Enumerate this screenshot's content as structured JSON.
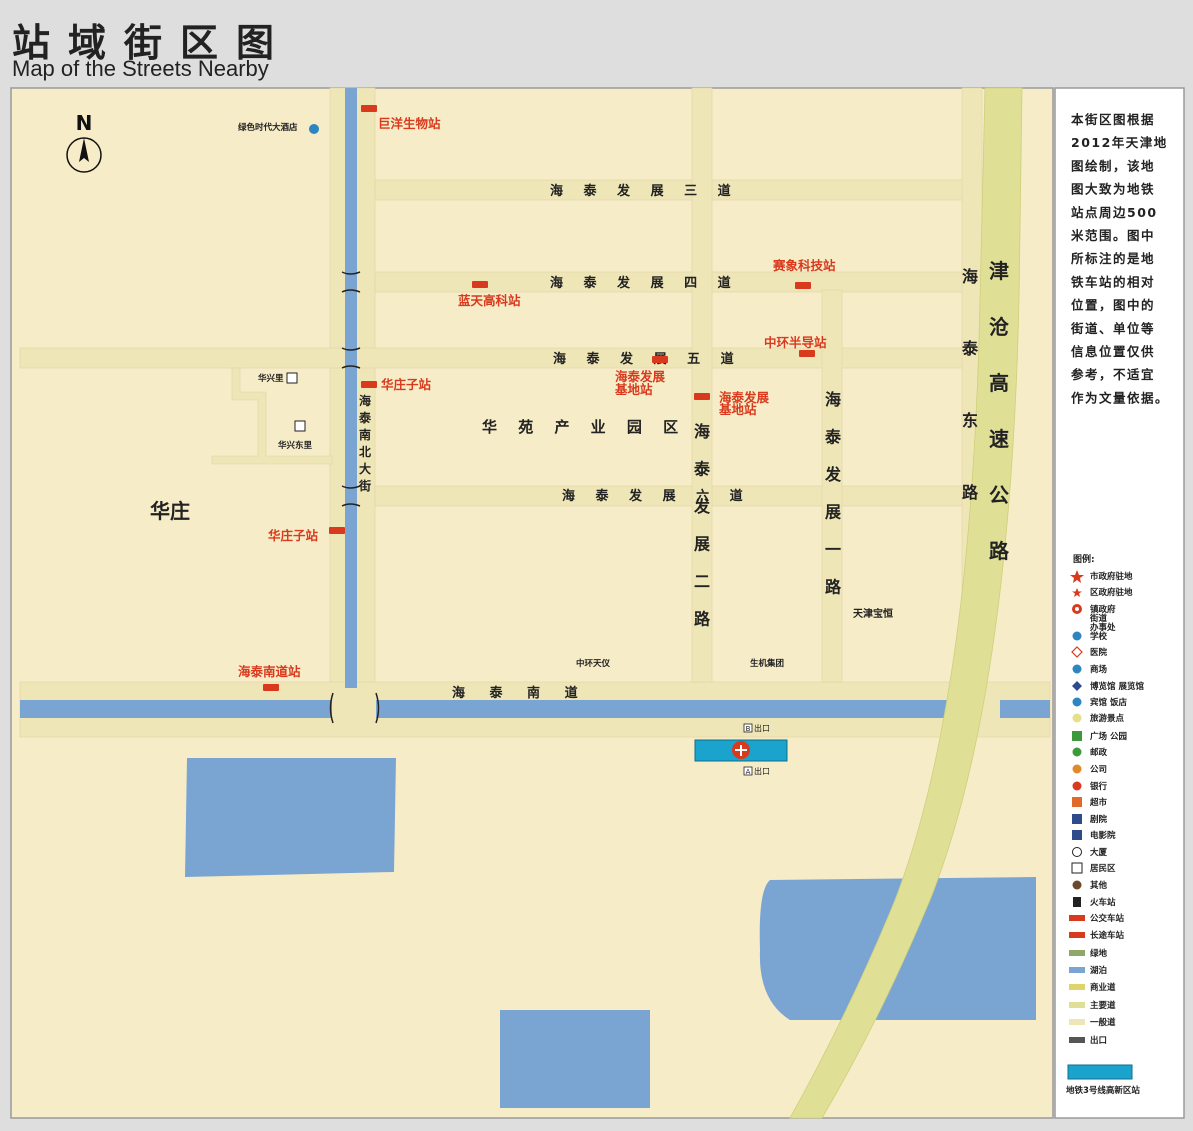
{
  "header": {
    "title_cn": "站域街区图",
    "title_en": "Map of the Streets Nearby"
  },
  "compass": {
    "label": "N"
  },
  "note": {
    "lines": [
      "本街区图根据",
      "2012年天津地",
      "图绘制，该地",
      "图大致为地铁",
      "站点周边500",
      "米范围。图中",
      "所标注的是地",
      "铁车站的相对",
      "位置，图中的",
      "街道、单位等",
      "信息位置仅供",
      "参考，不适宜",
      "作为文量依据。"
    ]
  },
  "roads": {
    "h_three": "海 泰 发 展 三 道",
    "h_four": "海 泰 发 展 四 道",
    "h_five": "海 泰 发 展 五 道",
    "h_six": "海 泰 发 展 六 道",
    "h_nan": "海 泰 南 道",
    "v_nanbei": "海泰南北大街",
    "v_two": "海泰发展二路",
    "v_one": "海泰发展一路",
    "v_dong": "海泰东路",
    "highway": "津沧高速公路"
  },
  "places": {
    "hotel": "绿色时代大酒店",
    "huaxingli": "华兴里",
    "huaxingdongli": "华兴东里",
    "huazhuang": "华庄",
    "park": "华 苑 产 业 园 区",
    "tianjin_baoheng": "天津宝恒",
    "zhonghuan_tianyi": "中环天仪",
    "shengji": "生机集团"
  },
  "bus_stops": {
    "juyang": "巨洋生物站",
    "saixiang": "赛象科技站",
    "lantian": "蓝天高科站",
    "zhonghuan": "中环半导站",
    "huazhuangzi1": "华庄子站",
    "jidi1_a": "海泰发展",
    "jidi1_b": "基地站",
    "jidi2_a": "海泰发展",
    "jidi2_b": "基地站",
    "huazhuangzi2": "华庄子站",
    "haitainan": "海泰南道站"
  },
  "station": {
    "exit_b": "出口",
    "exit_a": "出口",
    "exit_b_letter": "B",
    "exit_a_letter": "A"
  },
  "legend": {
    "title": "图例:",
    "items": [
      {
        "icon": "star-large-icon",
        "label": "市政府驻地"
      },
      {
        "icon": "star-small-icon",
        "label": "区政府驻地"
      },
      {
        "icon": "town-office-icon",
        "label": "镇政府"
      },
      {
        "icon": "school-icon",
        "label": "学校"
      },
      {
        "icon": "hospital-icon",
        "label": "医院"
      },
      {
        "icon": "mall-icon",
        "label": "商场"
      },
      {
        "icon": "museum-icon",
        "label": "博览馆  展览馆"
      },
      {
        "icon": "hotel-icon",
        "label": "宾馆  饭店"
      },
      {
        "icon": "scenic-icon",
        "label": "旅游景点"
      },
      {
        "icon": "square-icon",
        "label": "广场   公园"
      },
      {
        "icon": "post-icon",
        "label": "邮政"
      },
      {
        "icon": "company-icon",
        "label": "公司"
      },
      {
        "icon": "bank-icon",
        "label": "银行"
      },
      {
        "icon": "supermarket-icon",
        "label": "超市"
      },
      {
        "icon": "theater-icon",
        "label": "剧院"
      },
      {
        "icon": "cinema-icon",
        "label": "电影院"
      },
      {
        "icon": "building-icon",
        "label": "大厦"
      },
      {
        "icon": "residential-icon",
        "label": "居民区"
      },
      {
        "icon": "other-icon",
        "label": "其他"
      },
      {
        "icon": "train-icon",
        "label": "火车站"
      },
      {
        "icon": "bus-icon",
        "label": "公交车站"
      },
      {
        "icon": "coach-icon",
        "label": "长途车站"
      },
      {
        "icon": "green-icon",
        "label": "绿地"
      },
      {
        "icon": "lake-icon",
        "label": "湖泊"
      },
      {
        "icon": "commercial-road-icon",
        "label": "商业道"
      },
      {
        "icon": "main-road-icon",
        "label": "主要道"
      },
      {
        "icon": "general-road-icon",
        "label": "一般道"
      },
      {
        "icon": "exit-icon",
        "label": "出口"
      }
    ],
    "town_office_extra1": "街道",
    "town_office_extra2": "办事处",
    "metro_label": "地铁3号线高新区站"
  },
  "colors": {
    "land": "#f7ecc8",
    "road": "#efe6b8",
    "main_road": "#dfdf96",
    "water": "#7aa5d2",
    "bus_red": "#d93a1e",
    "metro": "#1aa3cc"
  }
}
